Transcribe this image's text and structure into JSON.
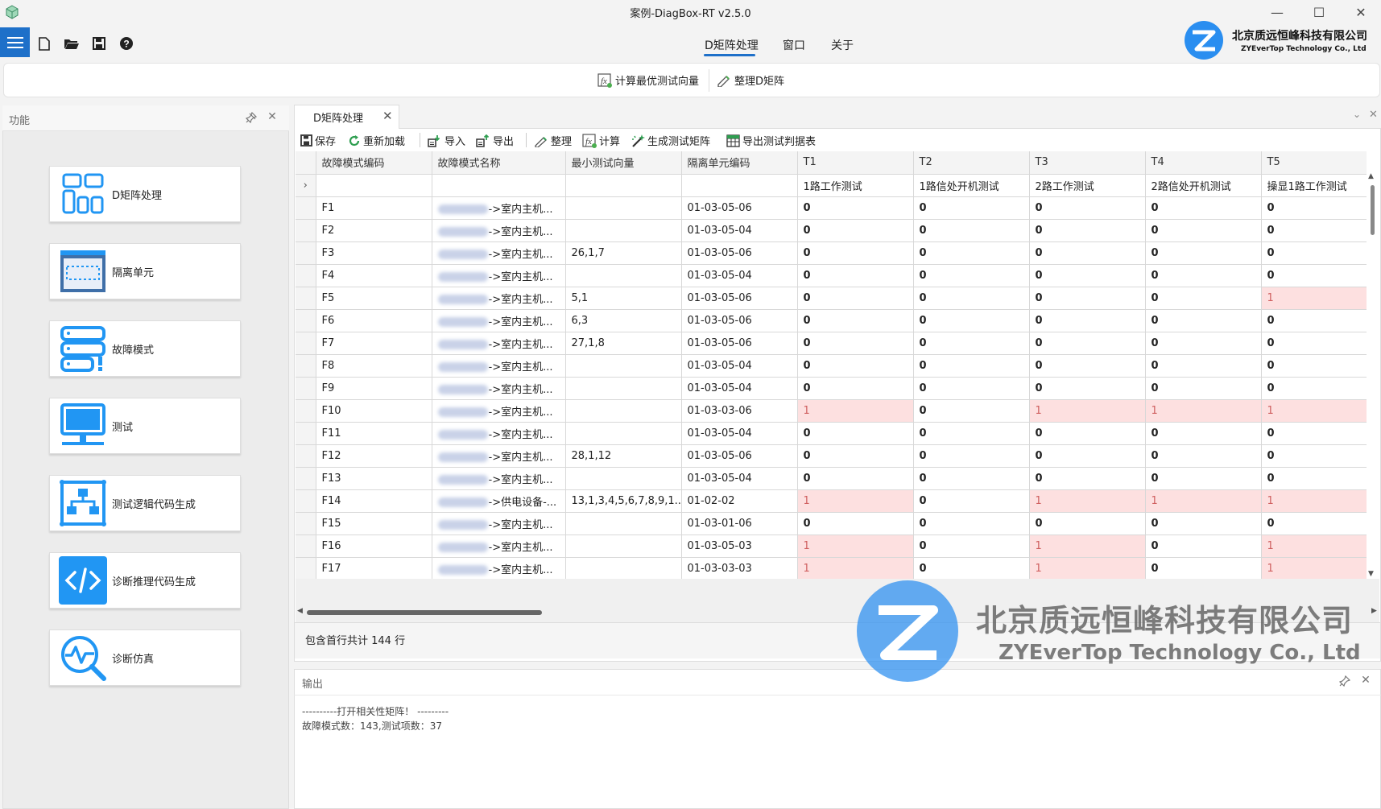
{
  "window": {
    "title": "案例-DiagBox-RT v2.5.0",
    "min": "—",
    "max": "☐",
    "close": "✕"
  },
  "menu": {
    "tabs": [
      "D矩阵处理",
      "窗口",
      "关于"
    ]
  },
  "logo": {
    "company_cn": "北京质远恒峰科技有限公司",
    "company_en": "ZYEverTop Technology Co., Ltd"
  },
  "ribbon": {
    "compute_label": "计算最优测试向量",
    "organize_label": "整理D矩阵"
  },
  "left_panel": {
    "title": "功能",
    "cards": [
      "D矩阵处理",
      "隔离单元",
      "故障模式",
      "测试",
      "测试逻辑代码生成",
      "诊断推理代码生成",
      "诊断仿真"
    ]
  },
  "document": {
    "tab_label": "D矩阵处理"
  },
  "toolbar": {
    "save": "保存",
    "reload": "重新加载",
    "import": "导入",
    "export": "导出",
    "organize": "整理",
    "compute": "计算",
    "generate": "生成测试矩阵",
    "export_table": "导出测试判据表"
  },
  "grid": {
    "columns": [
      "故障模式编码",
      "故障模式名称",
      "最小测试向量",
      "隔离单元编码",
      "T1",
      "T2",
      "T3",
      "T4",
      "T5"
    ],
    "subheader": [
      "",
      "",
      "",
      "",
      "1路工作测试",
      "1路信处开机测试",
      "2路工作测试",
      "2路信处开机测试",
      "操显1路工作测试"
    ],
    "selector": "›",
    "rows": [
      {
        "code": "F1",
        "name": "->室内主机...",
        "vec": "",
        "unit": "01-03-05-06",
        "t": [
          "0",
          "0",
          "0",
          "0",
          "0"
        ]
      },
      {
        "code": "F2",
        "name": "->室内主机...",
        "vec": "",
        "unit": "01-03-05-04",
        "t": [
          "0",
          "0",
          "0",
          "0",
          "0"
        ]
      },
      {
        "code": "F3",
        "name": "->室内主机...",
        "vec": "26,1,7",
        "unit": "01-03-05-06",
        "t": [
          "0",
          "0",
          "0",
          "0",
          "0"
        ]
      },
      {
        "code": "F4",
        "name": "->室内主机...",
        "vec": "",
        "unit": "01-03-05-04",
        "t": [
          "0",
          "0",
          "0",
          "0",
          "0"
        ]
      },
      {
        "code": "F5",
        "name": "->室内主机...",
        "vec": "5,1",
        "unit": "01-03-05-06",
        "t": [
          "0",
          "0",
          "0",
          "0",
          "1"
        ]
      },
      {
        "code": "F6",
        "name": "->室内主机...",
        "vec": "6,3",
        "unit": "01-03-05-06",
        "t": [
          "0",
          "0",
          "0",
          "0",
          "0"
        ]
      },
      {
        "code": "F7",
        "name": "->室内主机...",
        "vec": "27,1,8",
        "unit": "01-03-05-06",
        "t": [
          "0",
          "0",
          "0",
          "0",
          "0"
        ]
      },
      {
        "code": "F8",
        "name": "->室内主机...",
        "vec": "",
        "unit": "01-03-05-04",
        "t": [
          "0",
          "0",
          "0",
          "0",
          "0"
        ]
      },
      {
        "code": "F9",
        "name": "->室内主机...",
        "vec": "",
        "unit": "01-03-05-04",
        "t": [
          "0",
          "0",
          "0",
          "0",
          "0"
        ]
      },
      {
        "code": "F10",
        "name": "->室内主机...",
        "vec": "",
        "unit": "01-03-03-06",
        "t": [
          "1",
          "0",
          "1",
          "1",
          "1"
        ]
      },
      {
        "code": "F11",
        "name": "->室内主机...",
        "vec": "",
        "unit": "01-03-05-04",
        "t": [
          "0",
          "0",
          "0",
          "0",
          "0"
        ]
      },
      {
        "code": "F12",
        "name": "->室内主机...",
        "vec": "28,1,12",
        "unit": "01-03-05-06",
        "t": [
          "0",
          "0",
          "0",
          "0",
          "0"
        ]
      },
      {
        "code": "F13",
        "name": "->室内主机...",
        "vec": "",
        "unit": "01-03-05-04",
        "t": [
          "0",
          "0",
          "0",
          "0",
          "0"
        ]
      },
      {
        "code": "F14",
        "name": "->供电设备-...",
        "vec": "13,1,3,4,5,6,7,8,9,1...",
        "unit": "01-02-02",
        "t": [
          "1",
          "0",
          "1",
          "1",
          "1"
        ]
      },
      {
        "code": "F15",
        "name": "->室内主机...",
        "vec": "",
        "unit": "01-03-01-06",
        "t": [
          "0",
          "0",
          "0",
          "0",
          "0"
        ]
      },
      {
        "code": "F16",
        "name": "->室内主机...",
        "vec": "",
        "unit": "01-03-05-03",
        "t": [
          "1",
          "0",
          "1",
          "0",
          "1"
        ]
      },
      {
        "code": "F17",
        "name": "->室内主机...",
        "vec": "",
        "unit": "01-03-03-03",
        "t": [
          "1",
          "0",
          "1",
          "0",
          "1"
        ]
      }
    ]
  },
  "status": {
    "row_count_text": "包含首行共计 144 行"
  },
  "output": {
    "title": "输出",
    "lines": [
      "----------打开相关性矩阵！ ---------",
      "故障模式数：143,测试项数：37"
    ]
  },
  "colors": {
    "accent": "#1e70c9",
    "icon_blue": "#2196f3",
    "highlight": "#fde0e0"
  }
}
